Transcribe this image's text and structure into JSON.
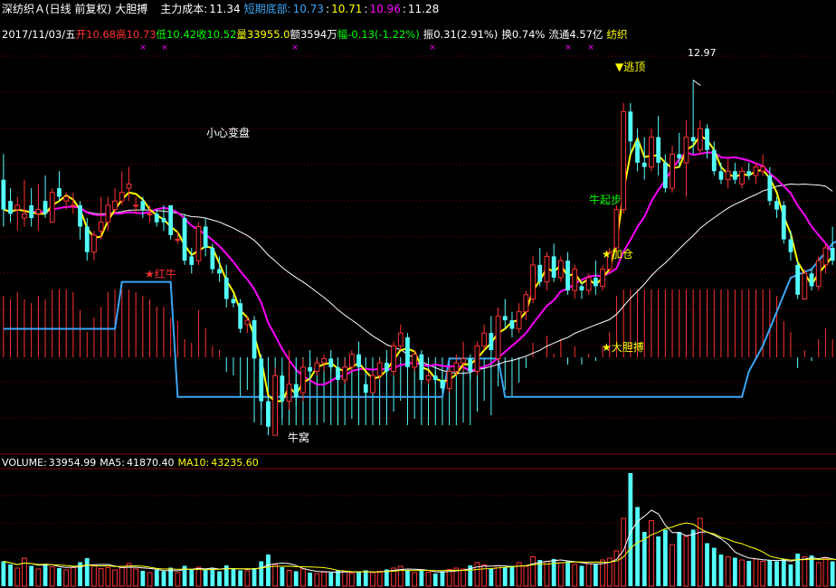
{
  "header": {
    "stock": "深纺织Ａ(日线 前复权)",
    "indicator": "大胆搏",
    "cost_label": "主力成本:",
    "cost_value": "11.34",
    "bottom_label": "短期底部:",
    "bottom_v1": "10.73",
    "bottom_sep1": ":",
    "bottom_v2": "10.71",
    "bottom_sep2": ":",
    "bottom_v3": "10.96",
    "bottom_sep3": ":",
    "bottom_v4": "11.28"
  },
  "quote": {
    "date": "2017/11/03/五",
    "open_label": "开",
    "open": "10.68",
    "high_label": "高",
    "high": "10.73",
    "low_label": "低",
    "low": "10.42",
    "close_label": "收",
    "close": "10.52",
    "vol_label": "量",
    "vol": "33955.0",
    "amt_label": "额",
    "amt": "3594万",
    "chg_label": "幅",
    "chg": "-0.13(-1.22%)",
    "amp_label": "振",
    "amp": "0.31(2.91%)",
    "turn_label": "换",
    "turn": "0.74%",
    "float_label": "流通",
    "float": "4.57亿",
    "sector": "纺织"
  },
  "volume_header": {
    "vol_label": "VOLUME:",
    "vol": "33954.99",
    "ma5_label": "MA5:",
    "ma5": "41870.40",
    "ma10_label": "MA10:",
    "ma10": "43235.60"
  },
  "annotations": {
    "caution": "小心变盘",
    "red_bull": "★红牛",
    "bull_start": "牛起步",
    "add_pos": "★加仓",
    "bold": "★大胆搏",
    "escape": "▼逃顶",
    "bull_nest": "牛窝",
    "high_mark": "12.97"
  },
  "colors": {
    "bg": "#000000",
    "up": "#ff3232",
    "down": "#54ffff",
    "ma_fast": "#ffff00",
    "ma_mid": "#ff00ff",
    "ma_slow": "#ffffff",
    "support": "#3ba7f5",
    "grid": "#800000",
    "green_text": "#00ff00",
    "magenta_mark": "#ff00ff"
  },
  "chart_data": {
    "type": "candlestick",
    "ylim": [
      8.6,
      13.4
    ],
    "vol_ylim": [
      0,
      260000
    ],
    "candles": [
      [
        11.8,
        12.1,
        11.25,
        11.45
      ],
      [
        11.55,
        11.7,
        11.3,
        11.4
      ],
      [
        11.45,
        11.6,
        11.2,
        11.5
      ],
      [
        11.35,
        11.8,
        11.25,
        11.4
      ],
      [
        11.5,
        11.7,
        11.25,
        11.35
      ],
      [
        11.4,
        11.75,
        11.2,
        11.45
      ],
      [
        11.55,
        11.85,
        11.35,
        11.4
      ],
      [
        11.3,
        11.7,
        11.3,
        11.65
      ],
      [
        11.7,
        11.9,
        11.55,
        11.6
      ],
      [
        11.55,
        11.65,
        11.45,
        11.6
      ],
      [
        11.5,
        11.65,
        11.4,
        11.5
      ],
      [
        11.5,
        11.55,
        11.1,
        11.25
      ],
      [
        11.25,
        11.35,
        10.85,
        10.95
      ],
      [
        10.95,
        11.2,
        10.85,
        11.15
      ],
      [
        11.2,
        11.6,
        11.1,
        11.3
      ],
      [
        11.3,
        11.6,
        11.2,
        11.5
      ],
      [
        11.45,
        11.7,
        11.4,
        11.55
      ],
      [
        11.55,
        11.9,
        11.5,
        11.65
      ],
      [
        11.7,
        11.95,
        11.55,
        11.75
      ],
      [
        11.5,
        11.6,
        11.4,
        11.5
      ],
      [
        11.55,
        11.6,
        11.35,
        11.45
      ],
      [
        11.4,
        11.5,
        11.3,
        11.4
      ],
      [
        11.4,
        11.45,
        11.25,
        11.3
      ],
      [
        11.35,
        11.5,
        11.2,
        11.3
      ],
      [
        11.5,
        11.5,
        11.1,
        11.15
      ],
      [
        11.1,
        11.2,
        11.05,
        11.1
      ],
      [
        11.35,
        11.4,
        10.8,
        10.85
      ],
      [
        10.9,
        11.0,
        10.7,
        10.8
      ],
      [
        10.85,
        11.3,
        10.8,
        11.25
      ],
      [
        11.25,
        11.35,
        10.9,
        11.0
      ],
      [
        11.0,
        11.05,
        10.7,
        10.75
      ],
      [
        10.75,
        10.9,
        10.6,
        10.7
      ],
      [
        10.65,
        10.8,
        10.3,
        10.4
      ],
      [
        10.4,
        10.45,
        10.3,
        10.35
      ],
      [
        10.35,
        10.4,
        10.0,
        10.05
      ],
      [
        10.1,
        10.2,
        10.0,
        10.15
      ],
      [
        10.15,
        10.2,
        9.55,
        9.7
      ],
      [
        9.7,
        9.75,
        9.1,
        9.2
      ],
      [
        9.2,
        9.25,
        8.8,
        8.9
      ],
      [
        8.8,
        9.6,
        8.8,
        9.5
      ],
      [
        9.5,
        9.55,
        9.0,
        9.2
      ],
      [
        9.2,
        9.8,
        9.1,
        9.4
      ],
      [
        9.4,
        9.6,
        9.15,
        9.25
      ],
      [
        9.3,
        9.7,
        9.2,
        9.6
      ],
      [
        9.6,
        9.8,
        9.45,
        9.55
      ],
      [
        9.55,
        9.7,
        9.5,
        9.65
      ],
      [
        9.65,
        9.75,
        9.55,
        9.7
      ],
      [
        9.7,
        9.8,
        9.55,
        9.6
      ],
      [
        9.6,
        9.65,
        9.35,
        9.45
      ],
      [
        9.45,
        9.7,
        9.4,
        9.6
      ],
      [
        9.6,
        9.8,
        9.55,
        9.75
      ],
      [
        9.75,
        9.9,
        9.55,
        9.6
      ],
      [
        9.4,
        9.45,
        9.25,
        9.3
      ],
      [
        9.3,
        9.55,
        9.3,
        9.5
      ],
      [
        9.5,
        9.7,
        9.45,
        9.65
      ],
      [
        9.65,
        9.8,
        9.5,
        9.55
      ],
      [
        9.55,
        9.9,
        9.5,
        9.85
      ],
      [
        9.85,
        10.1,
        9.8,
        10.0
      ],
      [
        9.95,
        10.0,
        9.55,
        9.6
      ],
      [
        9.6,
        9.8,
        9.55,
        9.75
      ],
      [
        9.75,
        9.8,
        9.4,
        9.45
      ],
      [
        9.45,
        9.55,
        9.4,
        9.5
      ],
      [
        9.5,
        9.55,
        9.4,
        9.45
      ],
      [
        9.45,
        9.55,
        9.3,
        9.35
      ],
      [
        9.35,
        9.6,
        9.3,
        9.55
      ],
      [
        9.55,
        9.75,
        9.5,
        9.65
      ],
      [
        9.65,
        9.9,
        9.55,
        9.7
      ],
      [
        9.7,
        9.75,
        9.45,
        9.55
      ],
      [
        9.55,
        9.9,
        9.5,
        9.85
      ],
      [
        9.85,
        10.1,
        9.8,
        10.0
      ],
      [
        10.0,
        10.2,
        9.7,
        9.8
      ],
      [
        9.7,
        10.3,
        9.65,
        10.2
      ],
      [
        10.2,
        10.4,
        10.05,
        10.15
      ],
      [
        10.15,
        10.25,
        9.95,
        10.05
      ],
      [
        10.05,
        10.35,
        10.0,
        10.25
      ],
      [
        10.25,
        10.5,
        10.15,
        10.45
      ],
      [
        10.4,
        10.9,
        10.35,
        10.8
      ],
      [
        10.8,
        11.0,
        10.55,
        10.6
      ],
      [
        10.6,
        10.95,
        10.5,
        10.9
      ],
      [
        10.9,
        11.05,
        10.6,
        10.65
      ],
      [
        10.65,
        10.9,
        10.6,
        10.85
      ],
      [
        10.85,
        10.95,
        10.45,
        10.5
      ],
      [
        10.5,
        10.8,
        10.4,
        10.75
      ],
      [
        10.55,
        10.6,
        10.4,
        10.5
      ],
      [
        10.5,
        10.7,
        10.45,
        10.65
      ],
      [
        10.65,
        10.85,
        10.45,
        10.55
      ],
      [
        10.55,
        10.8,
        10.5,
        10.75
      ],
      [
        10.75,
        11.0,
        10.7,
        10.95
      ],
      [
        11.0,
        11.5,
        10.95,
        11.45
      ],
      [
        11.45,
        12.7,
        11.4,
        12.6
      ],
      [
        12.6,
        12.7,
        12.1,
        12.25
      ],
      [
        12.25,
        12.4,
        11.9,
        12.0
      ],
      [
        12.0,
        12.3,
        11.8,
        11.95
      ],
      [
        11.95,
        12.4,
        11.9,
        12.3
      ],
      [
        12.3,
        12.55,
        11.85,
        12.0
      ],
      [
        12.0,
        12.1,
        11.65,
        11.7
      ],
      [
        11.7,
        12.2,
        11.65,
        12.1
      ],
      [
        12.1,
        12.35,
        11.95,
        12.05
      ],
      [
        12.0,
        12.5,
        11.6,
        12.3
      ],
      [
        12.3,
        12.97,
        12.1,
        12.25
      ],
      [
        12.15,
        12.5,
        12.1,
        12.4
      ],
      [
        12.4,
        12.45,
        12.05,
        12.15
      ],
      [
        12.15,
        12.25,
        11.85,
        11.9
      ],
      [
        11.9,
        12.0,
        11.75,
        11.8
      ],
      [
        11.8,
        12.05,
        11.7,
        11.9
      ],
      [
        11.9,
        12.0,
        11.75,
        11.8
      ],
      [
        11.75,
        11.95,
        11.7,
        11.9
      ],
      [
        11.9,
        12.0,
        11.8,
        11.85
      ],
      [
        11.85,
        12.0,
        11.75,
        11.95
      ],
      [
        11.9,
        12.1,
        11.85,
        11.95
      ],
      [
        11.85,
        11.95,
        11.5,
        11.55
      ],
      [
        11.55,
        11.6,
        11.35,
        11.45
      ],
      [
        11.5,
        11.55,
        11.05,
        11.1
      ],
      [
        11.1,
        11.2,
        10.85,
        10.95
      ],
      [
        10.8,
        10.85,
        10.4,
        10.45
      ],
      [
        10.4,
        10.75,
        10.4,
        10.7
      ],
      [
        10.7,
        10.75,
        10.5,
        10.55
      ],
      [
        10.55,
        10.9,
        10.5,
        10.85
      ],
      [
        10.8,
        11.05,
        10.7,
        11.0
      ],
      [
        11.0,
        11.25,
        10.8,
        10.85
      ]
    ],
    "volume": [
      55000,
      48000,
      40000,
      62000,
      45000,
      38000,
      50000,
      43000,
      40000,
      36000,
      41000,
      53000,
      62000,
      45000,
      39000,
      41000,
      36000,
      44000,
      50000,
      38000,
      34000,
      30000,
      36000,
      33000,
      41000,
      30000,
      45000,
      38000,
      42000,
      36000,
      40000,
      33000,
      46000,
      38000,
      35000,
      34000,
      40000,
      55000,
      70000,
      48000,
      42000,
      35000,
      33000,
      38000,
      30000,
      28000,
      31000,
      30000,
      35000,
      33000,
      29000,
      31000,
      35000,
      30000,
      33000,
      37000,
      40000,
      44000,
      36000,
      30000,
      34000,
      31000,
      28000,
      33000,
      37000,
      40000,
      38000,
      46000,
      52000,
      47000,
      38000,
      45000,
      42000,
      45000,
      52000,
      44000,
      65000,
      58000,
      55000,
      60000,
      52000,
      55000,
      48000,
      45000,
      50000,
      48000,
      58000,
      62000,
      78000,
      150000,
      250000,
      175000,
      120000,
      145000,
      110000,
      125000,
      92000,
      120000,
      110000,
      125000,
      150000,
      95000,
      85000,
      70000,
      65000,
      63000,
      58000,
      56000,
      60000,
      55000,
      58000,
      55000,
      60000,
      48000,
      72000,
      65000,
      68000,
      52000,
      62000,
      55000,
      48000,
      45000,
      40000,
      42000,
      38000
    ],
    "support_steps": [
      [
        0,
        10.05
      ],
      [
        16,
        10.05
      ],
      [
        17,
        10.6
      ],
      [
        24,
        10.6
      ],
      [
        25,
        9.25
      ],
      [
        43,
        9.25
      ],
      [
        53,
        9.25
      ],
      [
        62,
        9.25
      ],
      [
        63,
        9.25
      ],
      [
        64,
        9.7
      ],
      [
        71,
        9.7
      ],
      [
        72,
        9.25
      ],
      [
        83,
        9.25
      ],
      [
        100,
        9.25
      ],
      [
        101,
        9.25
      ],
      [
        104,
        9.25
      ],
      [
        105,
        9.25
      ],
      [
        106,
        9.25
      ]
    ]
  }
}
